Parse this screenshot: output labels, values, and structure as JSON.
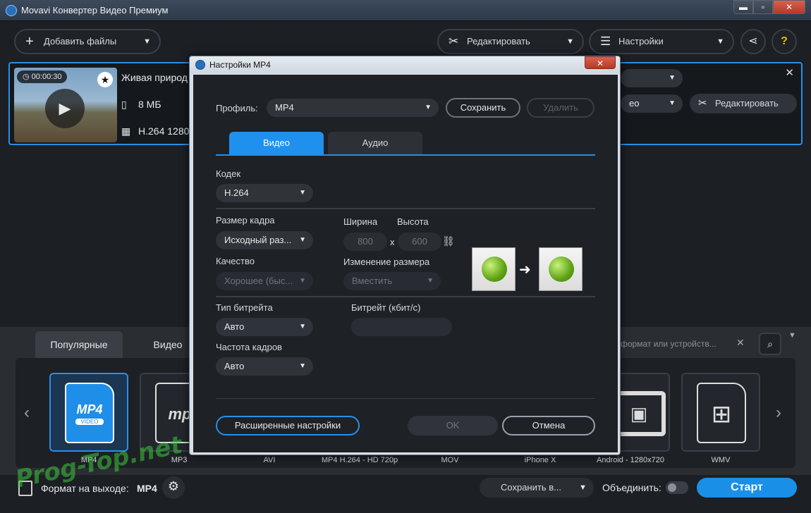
{
  "window": {
    "title": "Movavi Конвертер Видео Премиум",
    "min": "▬",
    "max": "▫",
    "close": "✕"
  },
  "toolbar": {
    "add_files": "Добавить файлы",
    "edit": "Редактировать",
    "settings": "Настройки",
    "share_icon": "share-icon",
    "help": "?"
  },
  "file": {
    "duration": "00:00:30",
    "name": "Живая природ",
    "size": "8 МБ",
    "codec": "H.264 1280",
    "right_dd_label": "ео",
    "edit_label": "Редактировать"
  },
  "formats": {
    "tabs": [
      "Популярные",
      "Видео"
    ],
    "search_placeholder": "формат или устройств...",
    "items": [
      {
        "label": "MP4",
        "tile_text": "MP4",
        "sub": "VIDEO"
      },
      {
        "label": "MP3",
        "tile_text": "mp"
      },
      {
        "label": "AVI"
      },
      {
        "label": "MP4 H.264 - HD 720p"
      },
      {
        "label": "MOV"
      },
      {
        "label": "iPhone X"
      },
      {
        "label": "Android - 1280x720"
      },
      {
        "label": "WMV"
      }
    ]
  },
  "footer": {
    "output_format_label": "Формат на выходе:",
    "output_format_value": "MP4",
    "save_to": "Сохранить в...",
    "merge": "Объединить:",
    "start": "Старт"
  },
  "watermark": "Prog-Top.net",
  "dialog": {
    "title": "Настройки MP4",
    "close": "✕",
    "profile_label": "Профиль:",
    "profile_value": "MP4",
    "save": "Сохранить",
    "delete": "Удалить",
    "tab_video": "Видео",
    "tab_audio": "Аудио",
    "codec_label": "Кодек",
    "codec_value": "H.264",
    "frame_size_label": "Размер кадра",
    "frame_size_value": "Исходный раз...",
    "width_label": "Ширина",
    "height_label": "Высота",
    "width_value": "800",
    "height_value": "600",
    "x": "x",
    "quality_label": "Качество",
    "quality_value": "Хорошее (быс...",
    "resize_label": "Изменение размера",
    "resize_value": "Вместить",
    "bitrate_type_label": "Тип битрейта",
    "bitrate_type_value": "Авто",
    "bitrate_label": "Битрейт (кбит/с)",
    "fps_label": "Частота кадров",
    "fps_value": "Авто",
    "advanced": "Расширенные настройки",
    "ok": "OK",
    "cancel": "Отмена"
  }
}
